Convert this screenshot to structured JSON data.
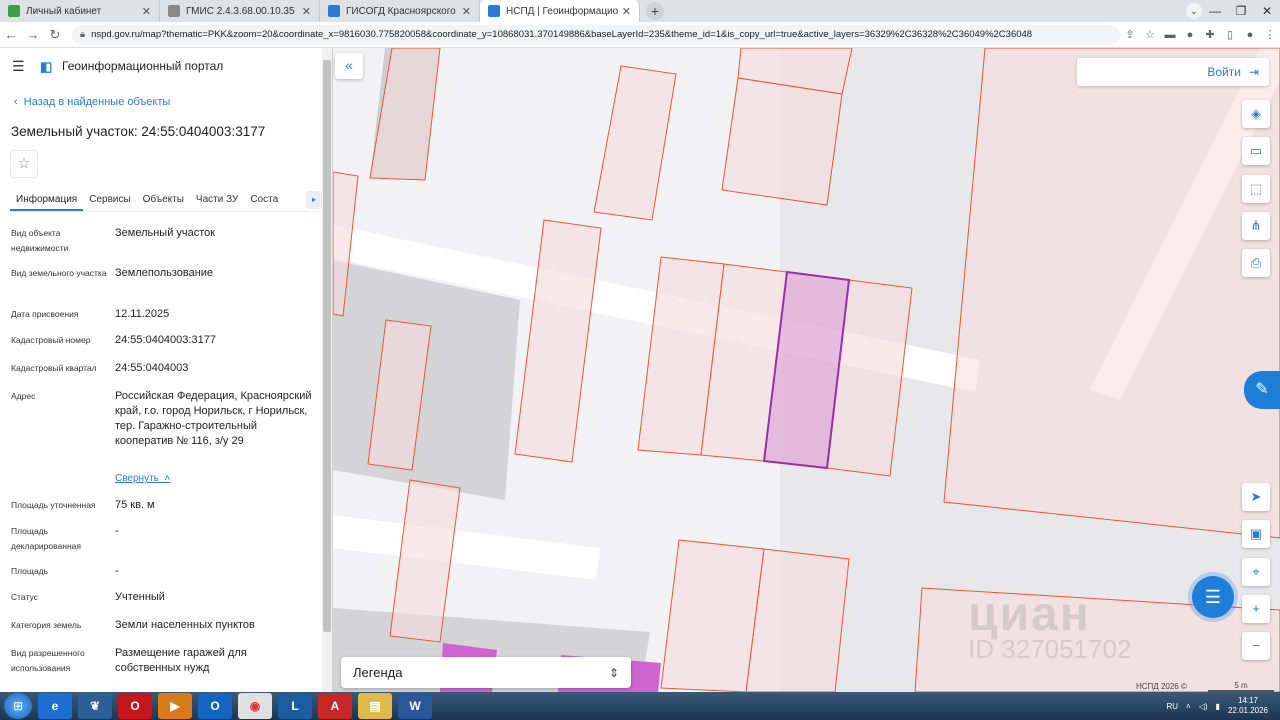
{
  "browser": {
    "tabs": [
      {
        "label": "Личный кабинет",
        "color": "#3aa14a"
      },
      {
        "label": "ГМИС 2.4.3.68.00.10.35",
        "color": "#888888"
      },
      {
        "label": "ГИСОГД Красноярского края",
        "color": "#2a7bd6"
      },
      {
        "label": "НСПД | Геоинформационный п",
        "color": "#2a7bd6"
      }
    ],
    "url": "nspd.gov.ru/map?thematic=PKK&zoom=20&coordinate_x=9816030.775820058&coordinate_y=10868031.370149886&baseLayerId=235&theme_id=1&is_copy_url=true&active_layers=36329%2C36328%2C36049%2C36048"
  },
  "portal": {
    "title": "Геоинформационный портал",
    "back_label": "Назад в найденные объекты",
    "object_title": "Земельный участок: 24:55:0404003:3177",
    "tabs": [
      "Информация",
      "Сервисы",
      "Объекты",
      "Части ЗУ",
      "Соста"
    ],
    "fields": [
      {
        "key": "Вид объекта недвижимости",
        "value": "Земельный участок"
      },
      {
        "key": "Вид земельного участка",
        "value": "Землепользование"
      },
      {
        "key": "Дата присвоения",
        "value": "12.11.2025"
      },
      {
        "key": "Кадастровый номер",
        "value": "24:55:0404003:3177"
      },
      {
        "key": "Кадастровый квартал",
        "value": "24:55:0404003"
      },
      {
        "key": "Адрес",
        "value": "Российская Федерация, Красноярский край, г.о. город Норильск, г Норильск, тер. Гаражно-строительный кооператив № 116, з/у 29"
      },
      {
        "key": "Площадь уточненная",
        "value": "75 кв. м"
      },
      {
        "key": "Площадь декларированная",
        "value": "-"
      },
      {
        "key": "Площадь",
        "value": "-"
      },
      {
        "key": "Статус",
        "value": "Учтенный"
      },
      {
        "key": "Категория земель",
        "value": "Земли населенных пунктов"
      },
      {
        "key": "Вид разрешенного использования",
        "value": "Размещение гаражей для собственных нужд"
      }
    ],
    "collapse_label": "Свернуть"
  },
  "map": {
    "login_label": "Войти",
    "legend_label": "Легенда",
    "watermark": "циан",
    "watermark_id": "ID 327051702",
    "copyright": "НСПД 2026 ©",
    "scale_label": "5 m"
  },
  "taskbar": {
    "lang": "RU",
    "time": "14:17",
    "date": "22.01.2026"
  },
  "colors": {
    "accent": "#2a7bd6",
    "parcel_fill": "#f7dada",
    "parcel_stroke": "#e8553f",
    "selected_fill": "#e2b2d8",
    "selected_stroke": "#9b2da8"
  }
}
